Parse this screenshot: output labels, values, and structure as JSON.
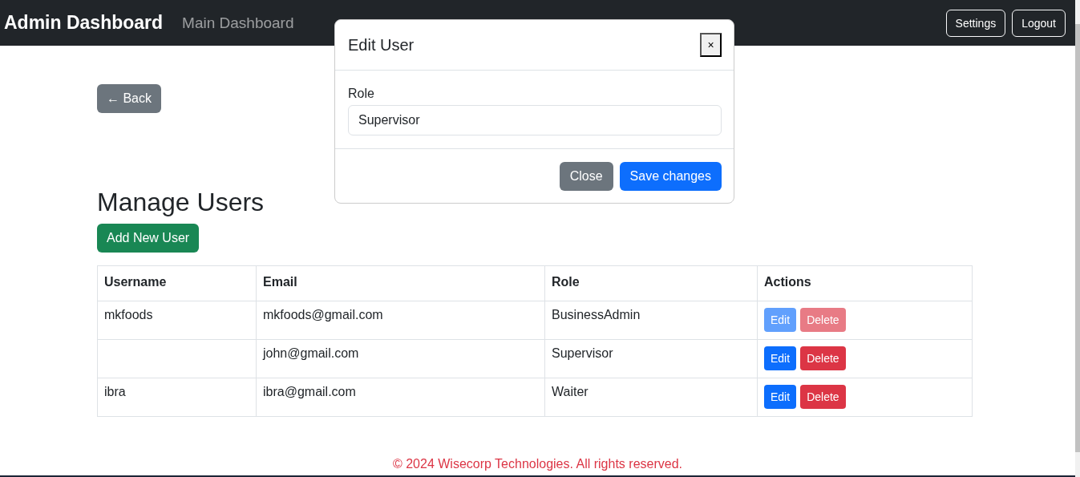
{
  "navbar": {
    "brand": "Admin Dashboard",
    "links": [
      "Main Dashboard"
    ],
    "buttons": [
      "Settings",
      "Logout"
    ]
  },
  "back_button": "← Back",
  "title": "Manage Users",
  "add_button": "Add New User",
  "table": {
    "columns": [
      "Username",
      "Email",
      "Role",
      "Actions"
    ],
    "rows": [
      {
        "username": "mkfoods",
        "email": "mkfoods@gmail.com",
        "role": "BusinessAdmin",
        "actions": [
          "Edit",
          "Delete"
        ],
        "disabled": true
      },
      {
        "username": "",
        "email": "john@gmail.com",
        "role": "Supervisor",
        "actions": [
          "Edit",
          "Delete"
        ],
        "disabled": false
      },
      {
        "username": "ibra",
        "email": "ibra@gmail.com",
        "role": "Waiter",
        "actions": [
          "Edit",
          "Delete"
        ],
        "disabled": false
      }
    ]
  },
  "modal": {
    "title": "Edit User",
    "close_icon": "×",
    "field_label": "Role",
    "field_value": "Supervisor",
    "buttons": [
      {
        "label": "Close",
        "kind": "secondary"
      },
      {
        "label": "Save changes",
        "kind": "primary"
      }
    ]
  },
  "footer": "© 2024 Wisecorp Technologies. All rights reserved."
}
